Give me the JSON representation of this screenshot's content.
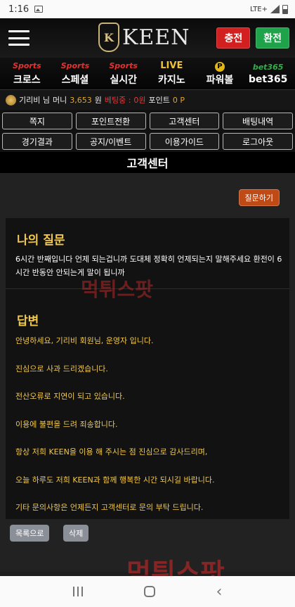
{
  "status": {
    "time": "1:16",
    "network": "LTE+"
  },
  "header": {
    "logo_text": "KEEN",
    "logo_badge": "K",
    "charge_label": "충전",
    "withdraw_label": "환전"
  },
  "nav": [
    {
      "logo": "Sports",
      "label": "크로스"
    },
    {
      "logo": "Sports",
      "label": "스페셜"
    },
    {
      "logo": "Sports",
      "label": "실시간"
    },
    {
      "logo": "LIVE",
      "label": "카지노"
    },
    {
      "logo": "P",
      "label": "파워볼"
    },
    {
      "logo": "bet365",
      "label": "bet365"
    }
  ],
  "user": {
    "name": "기리비 님",
    "money_label": "머니",
    "money": "3,653",
    "money_unit": "원",
    "betting_label": "베팅중 :",
    "betting": "0원",
    "point_label": "포인트",
    "point": "0 P"
  },
  "menu": [
    "쪽지",
    "포인트전환",
    "고객센터",
    "배팅내역",
    "경기결과",
    "공지/이벤트",
    "이용가이드",
    "로그아웃"
  ],
  "page_title": "고객센터",
  "ask_button": "질문하기",
  "question": {
    "title": "나의 질문",
    "text": "6시간 반째입니다 언제 되는겁니까 도대체 정확히 언제되는지 말해주세요 환전이 6시간 반동안 안되는게 말이 됩니까"
  },
  "answer": {
    "title": "답변",
    "lines": [
      "안녕하세요, 기리비 회원님, 운영자 입니다.",
      "진심으로 사과 드리겠습니다.",
      "전산오류로 지연이 되고 있습니다.",
      "이용에 불편을 드려 죄송합니다.",
      "항상 저희 KEEN을 이용 해 주시는 점 진심으로 감사드리며,",
      "오늘 하루도 저희 KEEN과 함께 행복한 시간 되시길 바랍니다.",
      "기타 문의사항은 언제든지 고객센터로 문의 부탁 드립니다."
    ]
  },
  "buttons": {
    "list": "목록으로",
    "delete": "삭제"
  },
  "watermark": "먹튀스팟"
}
